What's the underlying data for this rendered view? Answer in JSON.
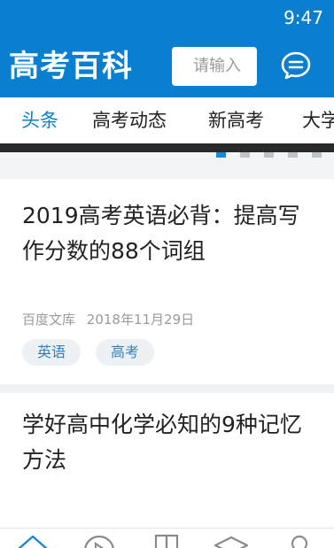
{
  "status_bar": {
    "time": "9:47"
  },
  "app_bar": {
    "logo_text": "高考百科",
    "search_placeholder": "请输入",
    "message_icon": "chat-bubble-icon"
  },
  "tabs": [
    {
      "label": "头条",
      "active": true
    },
    {
      "label": "高考动态",
      "active": false
    },
    {
      "label": "新高考",
      "active": false
    },
    {
      "label": "大学",
      "active": false
    }
  ],
  "carousel": {
    "page_count": 5,
    "active_index": 0
  },
  "articles": [
    {
      "title": "2019高考英语必背：提高写作分数的88个词组",
      "source": "百度文库",
      "date": "2018年11月29日",
      "tags": [
        "英语",
        "高考"
      ]
    },
    {
      "title": "学好高中化学必知的9种记忆方法",
      "source": "",
      "date": "",
      "tags": []
    }
  ],
  "bottom_nav": [
    {
      "icon": "home-icon",
      "active": true
    },
    {
      "icon": "play-icon",
      "active": false
    },
    {
      "icon": "books-icon",
      "active": false
    },
    {
      "icon": "graduation-cap-icon",
      "active": false
    },
    {
      "icon": "user-icon",
      "active": false
    }
  ],
  "colors": {
    "brand": "#0a7fcf",
    "tag_text": "#2d7fc1",
    "tag_bg": "#eef1f4"
  }
}
